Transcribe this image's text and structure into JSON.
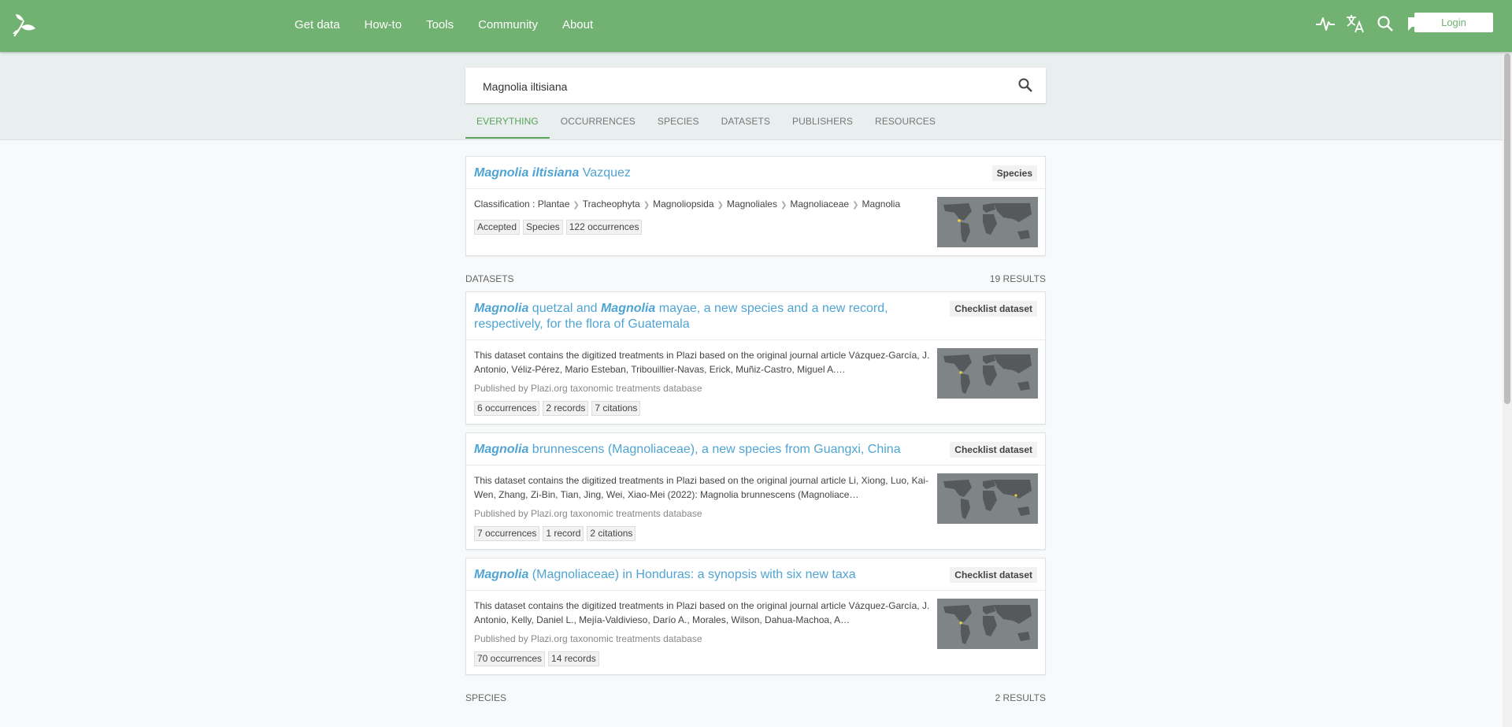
{
  "header": {
    "nav": [
      "Get data",
      "How-to",
      "Tools",
      "Community",
      "About"
    ],
    "icons": [
      "activity-icon",
      "translate-icon",
      "search-icon",
      "feedback-icon"
    ],
    "login_label": "Login"
  },
  "search": {
    "value": "Magnolia iltisiana",
    "tabs": [
      "EVERYTHING",
      "OCCURRENCES",
      "SPECIES",
      "DATASETS",
      "PUBLISHERS",
      "RESOURCES"
    ],
    "active_tab": "EVERYTHING"
  },
  "species_card": {
    "title_italic": "Magnolia iltisiana",
    "title_rest": " Vazquez",
    "badge": "Species",
    "classification_label": "Classification : ",
    "classification": [
      "Plantae",
      "Tracheophyta",
      "Magnoliopsida",
      "Magnoliales",
      "Magnoliaceae",
      "Magnolia"
    ],
    "tags": [
      "Accepted",
      "Species",
      "122 occurrences"
    ]
  },
  "datasets_section": {
    "label": "DATASETS",
    "count": "19 RESULTS",
    "items": [
      {
        "title_parts": [
          {
            "text": "Magnolia",
            "italic": true
          },
          {
            "text": " quetzal and ",
            "italic": false
          },
          {
            "text": "Magnolia",
            "italic": true
          },
          {
            "text": " mayae, a new species and a new record, respectively, for the flora of Guatemala",
            "italic": false
          }
        ],
        "badge": "Checklist dataset",
        "description": "This dataset contains the digitized treatments in Plazi based on the original journal article Vázquez-García, J. Antonio, Véliz-Pérez, Mario Esteban, Tribouillier-Navas, Erick, Muñiz-Castro, Miguel A.…",
        "publisher": "Published by Plazi.org taxonomic treatments database",
        "tags": [
          "6 occurrences",
          "2 records",
          "7 citations"
        ]
      },
      {
        "title_parts": [
          {
            "text": "Magnolia",
            "italic": true
          },
          {
            "text": " brunnescens (Magnoliaceae), a new species from Guangxi, China",
            "italic": false
          }
        ],
        "badge": "Checklist dataset",
        "description": "This dataset contains the digitized treatments in Plazi based on the original journal article Li, Xiong, Luo, Kai-Wen, Zhang, Zi-Bin, Tian, Jing, Wei, Xiao-Mei (2022): Magnolia brunnescens (Magnoliace…",
        "publisher": "Published by Plazi.org taxonomic treatments database",
        "tags": [
          "7 occurrences",
          "1 record",
          "2 citations"
        ]
      },
      {
        "title_parts": [
          {
            "text": "Magnolia",
            "italic": true
          },
          {
            "text": " (Magnoliaceae) in Honduras: a synopsis with six new taxa",
            "italic": false
          }
        ],
        "badge": "Checklist dataset",
        "description": "This dataset contains the digitized treatments in Plazi based on the original journal article Vázquez-García, J. Antonio, Kelly, Daniel L., Mejía-Valdivieso, Darío A., Morales, Wilson, Dahua-Machoa, A…",
        "publisher": "Published by Plazi.org taxonomic treatments database",
        "tags": [
          "70 occurrences",
          "14 records"
        ]
      }
    ]
  },
  "species_section": {
    "label": "SPECIES",
    "count": "2 RESULTS"
  },
  "colors": {
    "header_green": "#71b171",
    "link_blue": "#4fa4d3",
    "active_tab_green": "#5aa35a"
  }
}
